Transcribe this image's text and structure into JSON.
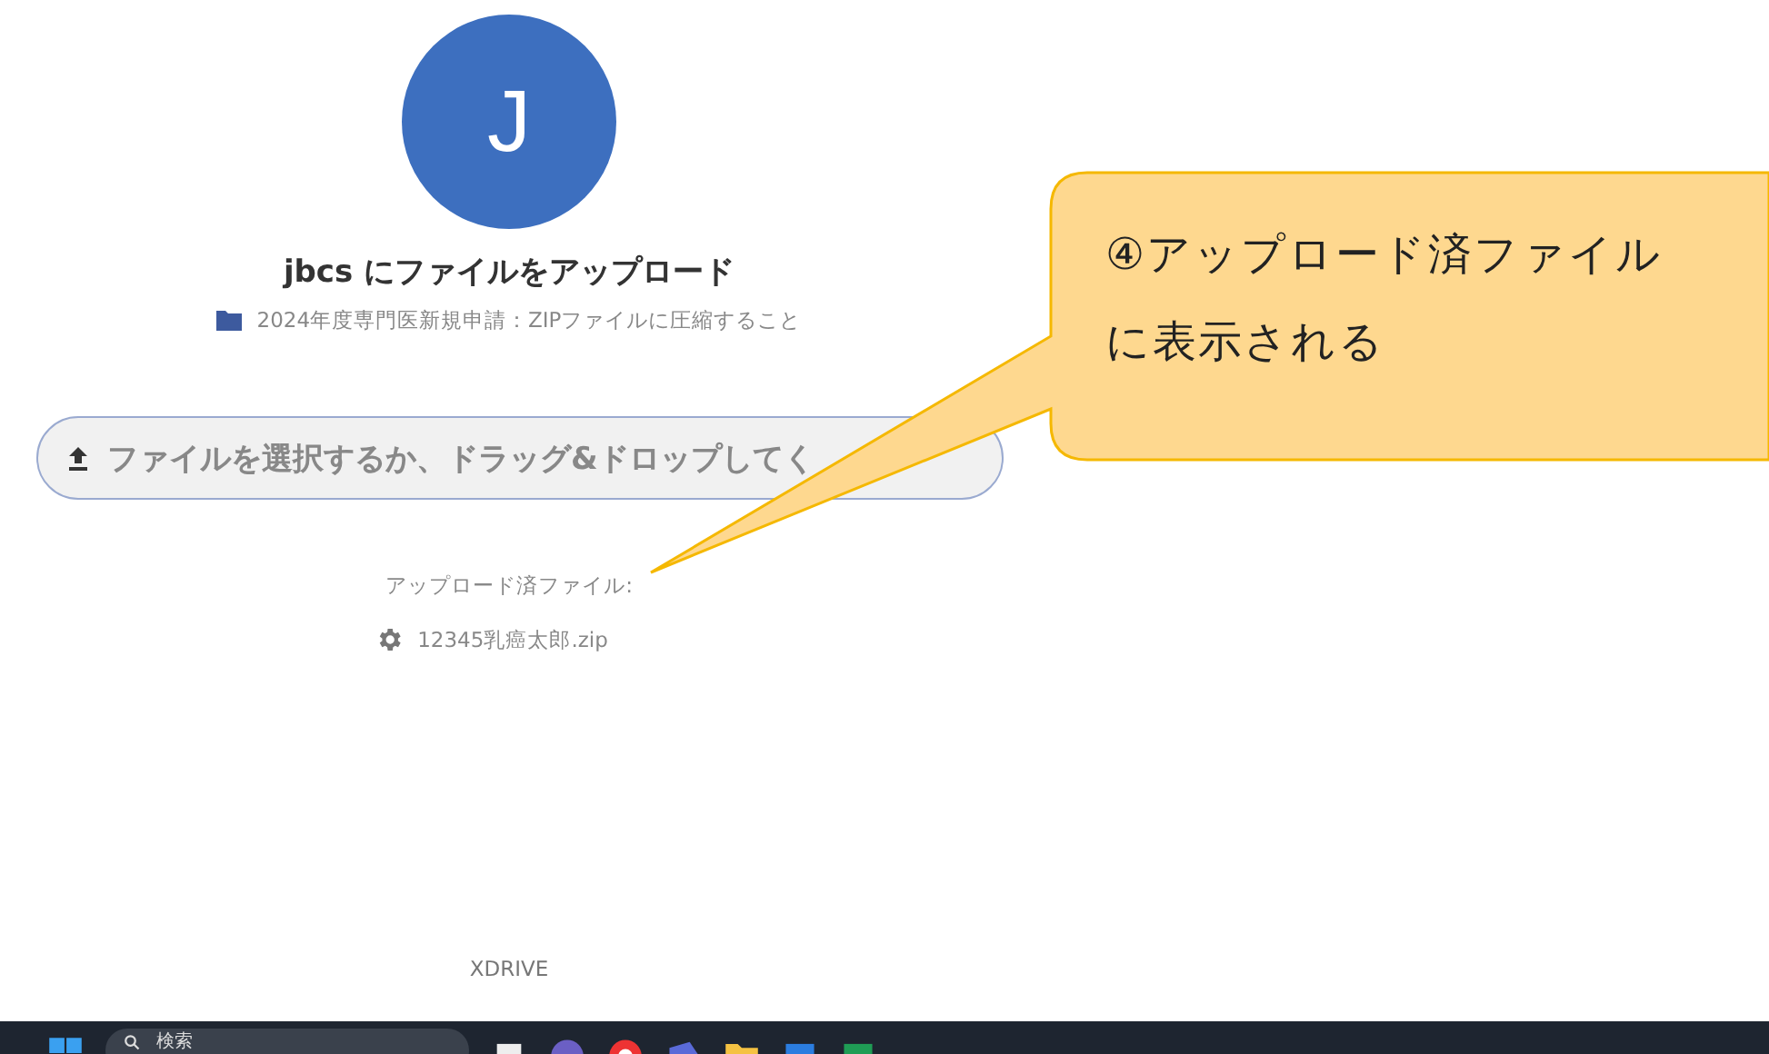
{
  "avatar": {
    "letter": "J"
  },
  "title": "jbcs にファイルをアップロード",
  "folder": "2024年度専門医新規申請：ZIPファイルに圧縮すること",
  "upload_button": {
    "label": "ファイルを選択するか、ドラッグ&ドロップしてく"
  },
  "uploaded": {
    "label": "アップロード済ファイル:",
    "files": [
      {
        "name": "12345乳癌太郎.zip"
      }
    ]
  },
  "footer": "XDRIVE",
  "callout": {
    "lines": [
      "④アップロード済ファイル",
      "に表示される"
    ]
  },
  "taskbar": {
    "search_placeholder": "検索"
  }
}
